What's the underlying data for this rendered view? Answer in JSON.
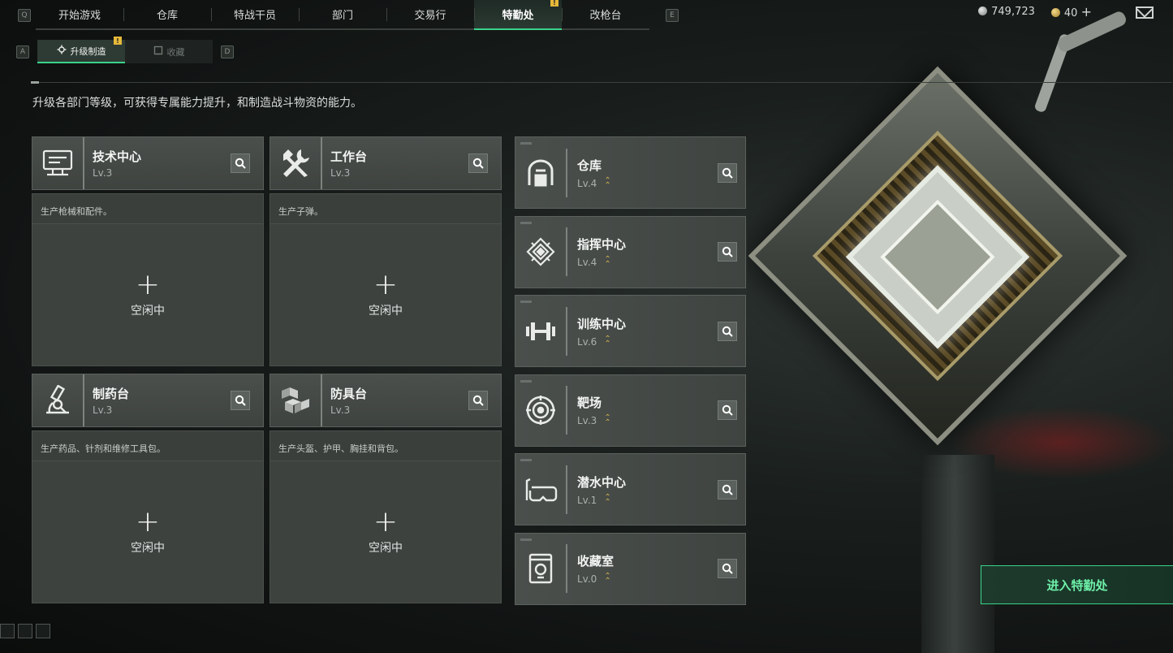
{
  "top_nav": {
    "left_key": "Q",
    "right_key": "E",
    "tabs": [
      {
        "label": "开始游戏",
        "active": false,
        "badge": ""
      },
      {
        "label": "仓库",
        "active": false,
        "badge": ""
      },
      {
        "label": "特战干员",
        "active": false,
        "badge": ""
      },
      {
        "label": "部门",
        "active": false,
        "badge": ""
      },
      {
        "label": "交易行",
        "active": false,
        "badge": ""
      },
      {
        "label": "特勤处",
        "active": true,
        "badge": "!"
      },
      {
        "label": "改枪台",
        "active": false,
        "badge": ""
      }
    ]
  },
  "currency": {
    "coins": "749,723",
    "tickets": "40",
    "tickets_add": "+"
  },
  "sub_nav": {
    "left_key": "A",
    "right_key": "D",
    "tabs": [
      {
        "label": "升级制造",
        "active": true,
        "badge": "!"
      },
      {
        "label": "收藏",
        "active": false,
        "badge": ""
      }
    ]
  },
  "page_description": "升级各部门等级，可获得专属能力提升，和制造战斗物资的能力。",
  "production": [
    {
      "name": "技术中心",
      "level": "Lv.3",
      "icon": "computer-icon",
      "description": "生产枪械和配件。",
      "status": "空闲中",
      "plus": "+"
    },
    {
      "name": "工作台",
      "level": "Lv.3",
      "icon": "tools-icon",
      "description": "生产子弹。",
      "status": "空闲中",
      "plus": "+"
    },
    {
      "name": "制药台",
      "level": "Lv.3",
      "icon": "microscope-icon",
      "description": "生产药品、针剂和维修工具包。",
      "status": "空闲中",
      "plus": "+"
    },
    {
      "name": "防具台",
      "level": "Lv.3",
      "icon": "boxes-icon",
      "description": "生产头盔、护甲、胸挂和背包。",
      "status": "空闲中",
      "plus": "+"
    }
  ],
  "departments": [
    {
      "name": "仓库",
      "level": "Lv.4",
      "icon": "warehouse-icon"
    },
    {
      "name": "指挥中心",
      "level": "Lv.4",
      "icon": "chip-icon"
    },
    {
      "name": "训练中心",
      "level": "Lv.6",
      "icon": "dumbbell-icon"
    },
    {
      "name": "靶场",
      "level": "Lv.3",
      "icon": "target-icon"
    },
    {
      "name": "潜水中心",
      "level": "Lv.1",
      "icon": "diving-mask-icon"
    },
    {
      "name": "收藏室",
      "level": "Lv.0",
      "icon": "display-case-icon"
    }
  ],
  "enter_button": "进入特勤处",
  "colors": {
    "accent_green": "#3ad38a",
    "warning_yellow": "#e6b93a",
    "upgrade_gold": "#d1b250"
  }
}
